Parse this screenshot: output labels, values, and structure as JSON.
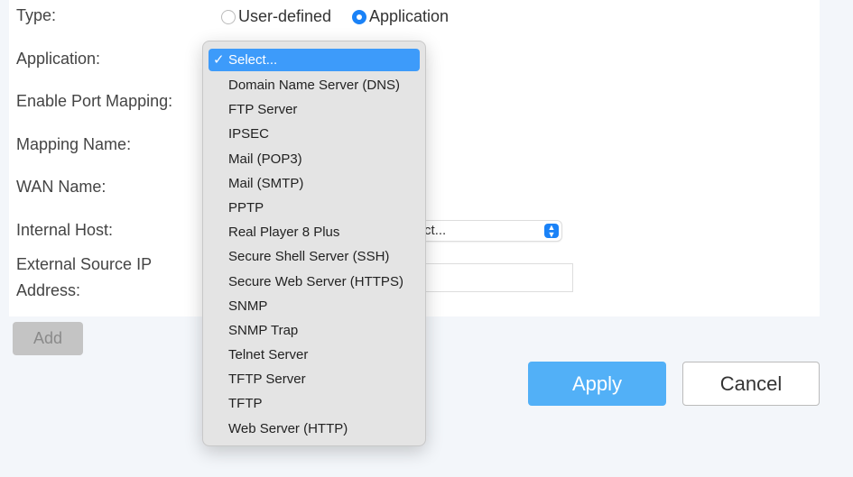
{
  "form": {
    "type_label": "Type:",
    "type_options": [
      "User-defined",
      "Application"
    ],
    "type_selected": "Application",
    "application_label": "Application:",
    "enable_port_mapping_label": "Enable Port Mapping:",
    "mapping_name_label": "Mapping Name:",
    "wan_name_label": "WAN Name:",
    "internal_host_label": "Internal Host:",
    "internal_host_value": "Select...",
    "external_ip_label_1": "External Source IP",
    "external_ip_label_2": "Address:",
    "external_ip_value": ""
  },
  "buttons": {
    "add": "Add",
    "apply": "Apply",
    "cancel": "Cancel"
  },
  "dropdown": {
    "check": "✓",
    "selected": "Select...",
    "items": [
      "Select...",
      "Domain Name Server (DNS)",
      "FTP Server",
      "IPSEC",
      "Mail (POP3)",
      "Mail (SMTP)",
      "PPTP",
      "Real Player 8 Plus",
      "Secure Shell Server (SSH)",
      "Secure Web Server (HTTPS)",
      "SNMP",
      "SNMP Trap",
      "Telnet Server",
      "TFTP Server",
      "TFTP",
      "Web Server (HTTP)"
    ]
  },
  "colors": {
    "accent": "#1a82f7",
    "highlight": "#3d9bfa",
    "apply": "#52b0f7"
  }
}
